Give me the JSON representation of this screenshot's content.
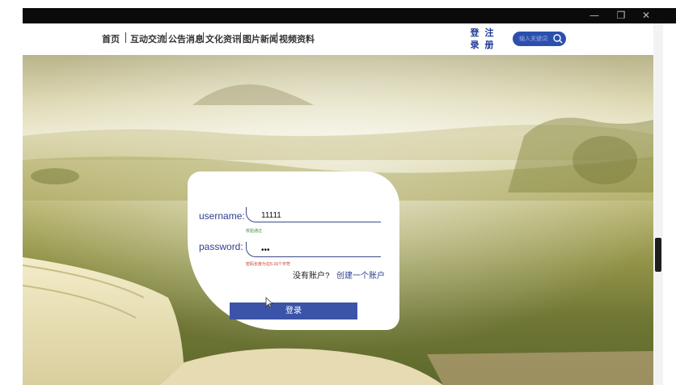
{
  "window": {
    "minimize": "—",
    "restore": "❐",
    "close": "✕"
  },
  "nav": {
    "items": [
      "首页",
      "互动交流",
      "公告消息",
      "文化资讯",
      "图片新闻",
      "视频资料"
    ],
    "login": [
      "登",
      "录"
    ],
    "register": [
      "注",
      "册"
    ],
    "search_placeholder": "输入关键词",
    "search_icon": "search-icon"
  },
  "form": {
    "username_label": "username:",
    "username_value": "11111",
    "username_hint": "校验通过",
    "password_label": "password:",
    "password_value": "•••",
    "password_hint": "密码长度为在5-16个字符",
    "no_account": "没有账户?",
    "create_account": "创建一个账户",
    "login_button": "登录"
  },
  "colors": {
    "accent": "#3b54a8",
    "nav_text": "#333333",
    "success": "#3a8a3a",
    "error": "#c0392b",
    "link": "#2f3f8f"
  }
}
